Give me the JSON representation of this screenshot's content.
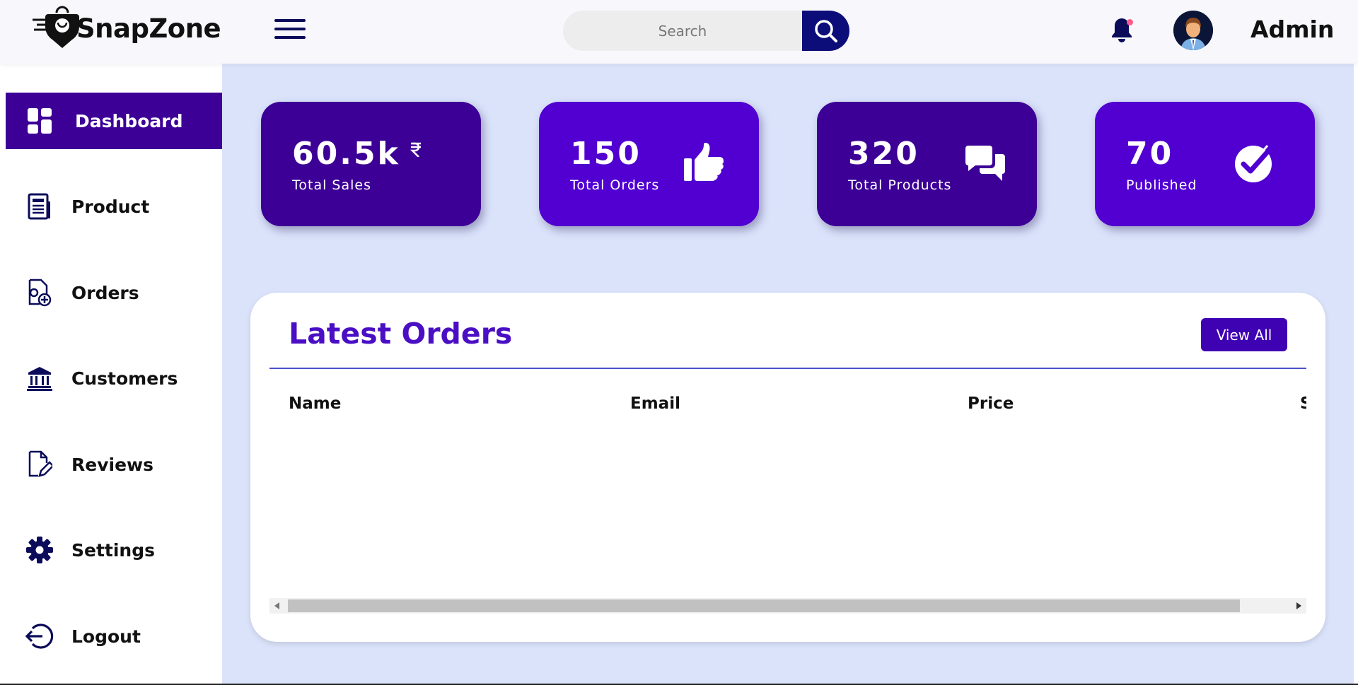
{
  "header": {
    "brand": "SnapZone",
    "search_placeholder": "Search",
    "user_name": "Admin"
  },
  "sidebar": {
    "items": [
      {
        "label": "Dashboard",
        "icon": "dashboard-icon",
        "active": true
      },
      {
        "label": "Product",
        "icon": "document-list-icon"
      },
      {
        "label": "Orders",
        "icon": "file-add-icon"
      },
      {
        "label": "Customers",
        "icon": "bank-icon"
      },
      {
        "label": "Reviews",
        "icon": "edit-document-icon"
      },
      {
        "label": "Settings",
        "icon": "gear-icon"
      },
      {
        "label": "Logout",
        "icon": "logout-icon"
      }
    ]
  },
  "stats": [
    {
      "value": "60.5k",
      "label": "Total Sales",
      "icon": "rupee-icon",
      "color": "#3d0096"
    },
    {
      "value": "150",
      "label": "Total Orders",
      "icon": "thumbs-up-icon",
      "color": "#5100d1"
    },
    {
      "value": "320",
      "label": "Total Products",
      "icon": "chat-bubbles-icon",
      "color": "#3d0096"
    },
    {
      "value": "70",
      "label": "Published",
      "icon": "check-circle-icon",
      "color": "#5100d1"
    }
  ],
  "orders": {
    "title": "Latest Orders",
    "view_all_label": "View All",
    "columns": [
      "Name",
      "Email",
      "Price",
      "Status"
    ],
    "rows": []
  },
  "colors": {
    "accent": "#3d0096",
    "navy": "#0d0d7a",
    "main_bg": "#dbe3fb",
    "title_purple": "#4a0fc4"
  }
}
